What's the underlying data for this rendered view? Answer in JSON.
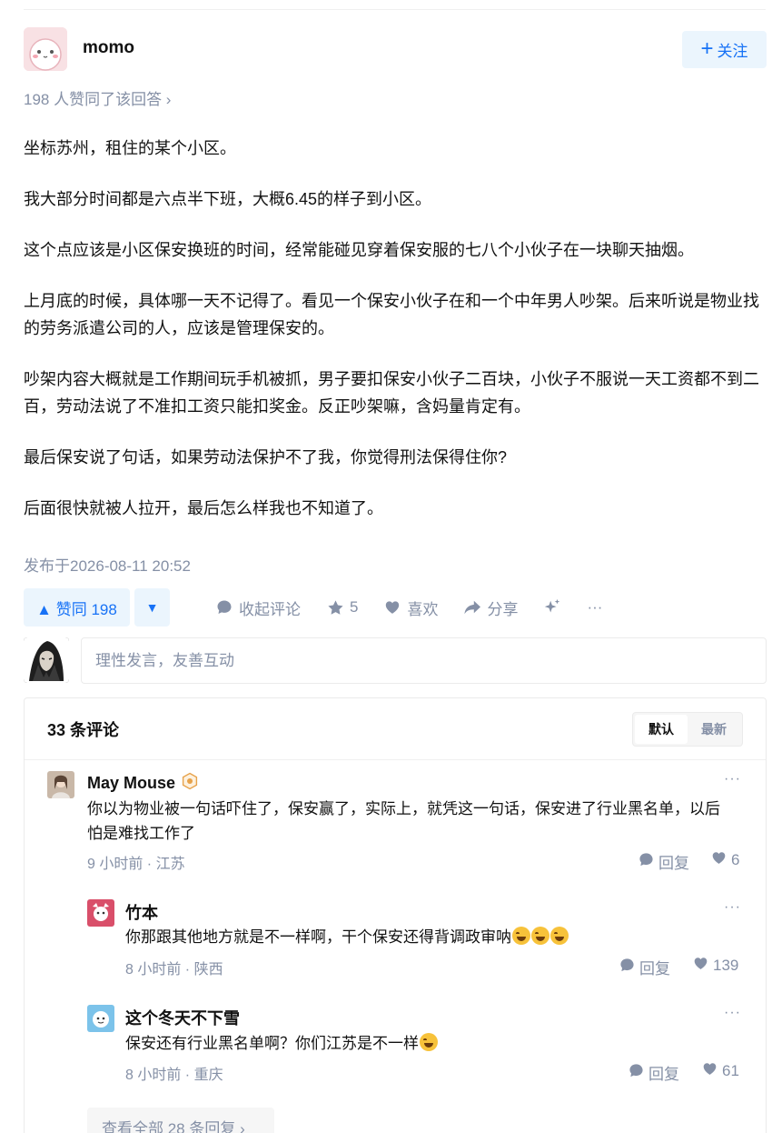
{
  "author": {
    "name": "momo",
    "follow_label": "关注",
    "follow_icon": "plus-icon"
  },
  "upvoted_line": "198 人赞同了该回答 ›",
  "article": {
    "paragraphs": [
      "坐标苏州，租住的某个小区。",
      "我大部分时间都是六点半下班，大概6.45的样子到小区。",
      "这个点应该是小区保安换班的时间，经常能碰见穿着保安服的七八个小伙子在一块聊天抽烟。",
      "上月底的时候，具体哪一天不记得了。看见一个保安小伙子在和一个中年男人吵架。后来听说是物业找的劳务派遣公司的人，应该是管理保安的。",
      "吵架内容大概就是工作期间玩手机被抓，男子要扣保安小伙子二百块，小伙子不服说一天工资都不到二百，劳动法说了不准扣工资只能扣奖金。反正吵架嘛，含妈量肯定有。",
      "最后保安说了句话，如果劳动法保护不了我，你觉得刑法保得住你?",
      "后面很快就被人拉开，最后怎么样我也不知道了。"
    ],
    "published": "发布于2026-08-11 20:52"
  },
  "actions": {
    "upvote_label": "▲ 赞同 198",
    "collapse_comments": "收起评论",
    "favorite_count": "5",
    "like_label": "喜欢",
    "share_label": "分享",
    "more": "···"
  },
  "comment_input": {
    "placeholder": "理性发言，友善互动"
  },
  "comments": {
    "title": "33 条评论",
    "sort": {
      "default": "默认",
      "latest": "最新"
    },
    "items": [
      {
        "name": "May Mouse",
        "text": "你以为物业被一句话吓住了，保安赢了，实际上，就凭这一句话，保安进了行业黑名单，以后怕是难找工作了",
        "meta": "9 小时前 · 江苏",
        "reply": "回复",
        "likes": "6",
        "more": "···"
      },
      {
        "name": "竹本",
        "text": "你那跟其他地方就是不一样啊，干个保安还得背调政审呐",
        "meta": "8 小时前 · 陕西",
        "reply": "回复",
        "likes": "139",
        "more": "···"
      },
      {
        "name": "这个冬天不下雪",
        "text": "保安还有行业黑名单啊？你们江苏是不一样",
        "meta": "8 小时前 · 重庆",
        "reply": "回复",
        "likes": "61",
        "more": "···"
      }
    ],
    "view_all": "查看全部 28 条回复 ›"
  }
}
